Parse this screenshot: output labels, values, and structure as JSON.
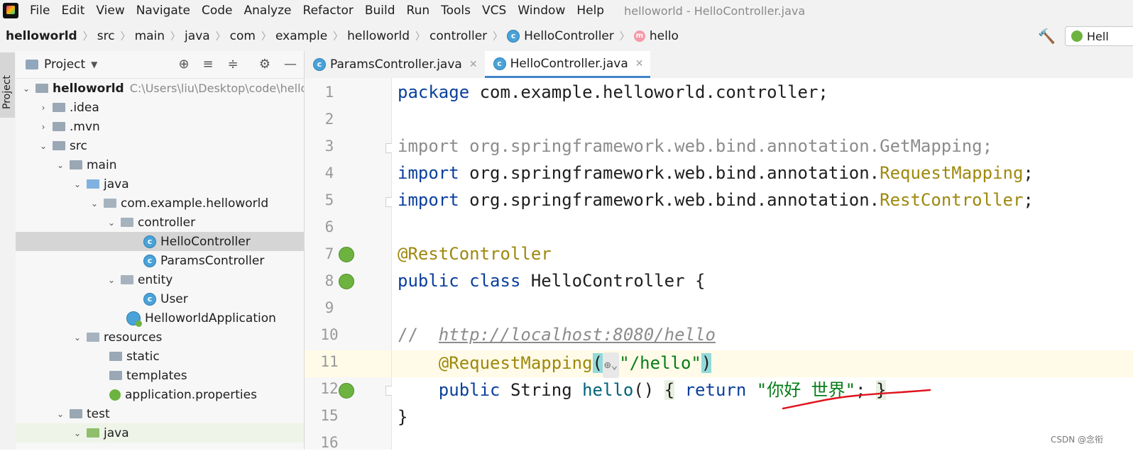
{
  "menu": {
    "items": [
      "File",
      "Edit",
      "View",
      "Navigate",
      "Code",
      "Analyze",
      "Refactor",
      "Build",
      "Run",
      "Tools",
      "VCS",
      "Window",
      "Help"
    ],
    "window_title": "helloworld - HelloController.java"
  },
  "breadcrumb": {
    "items": [
      "helloworld",
      "src",
      "main",
      "java",
      "com",
      "example",
      "helloworld",
      "controller",
      "HelloController",
      "hello"
    ],
    "run_config": "Hell"
  },
  "tool_strip": {
    "project_tab": "Project"
  },
  "project_panel": {
    "title": "Project",
    "tree": [
      {
        "label": "helloworld",
        "path": "C:\\Users\\liu\\Desktop\\code\\hello"
      },
      {
        "label": ".idea"
      },
      {
        "label": ".mvn"
      },
      {
        "label": "src"
      },
      {
        "label": "main"
      },
      {
        "label": "java"
      },
      {
        "label": "com.example.helloworld"
      },
      {
        "label": "controller"
      },
      {
        "label": "HelloController"
      },
      {
        "label": "ParamsController"
      },
      {
        "label": "entity"
      },
      {
        "label": "User"
      },
      {
        "label": "HelloworldApplication"
      },
      {
        "label": "resources"
      },
      {
        "label": "static"
      },
      {
        "label": "templates"
      },
      {
        "label": "application.properties"
      },
      {
        "label": "test"
      },
      {
        "label": "java"
      }
    ]
  },
  "editor": {
    "tabs": [
      {
        "label": "ParamsController.java",
        "active": false
      },
      {
        "label": "HelloController.java",
        "active": true
      }
    ],
    "line_numbers": [
      "1",
      "2",
      "3",
      "4",
      "5",
      "6",
      "7",
      "8",
      "9",
      "10",
      "11",
      "12",
      "15",
      "16"
    ],
    "code": {
      "l1_kw": "package",
      "l1_rest": " com.example.helloworld.controller;",
      "l3": "import org.springframework.web.bind.annotation.GetMapping;",
      "l4_kw": "import",
      "l4_rest": " org.springframework.web.bind.annotation.",
      "l4_cls": "RequestMapping",
      "l4_end": ";",
      "l5_kw": "import",
      "l5_rest": " org.springframework.web.bind.annotation.",
      "l5_cls": "RestController",
      "l5_end": ";",
      "l7": "@RestController",
      "l8_kw": "public class",
      "l8_rest": " HelloController {",
      "l10_cmt": "//  ",
      "l10_url": "http://localhost:8080/hello",
      "l11_ann": "    @RequestMapping",
      "l11_open": "(",
      "l11_str": "\"/hello\"",
      "l11_close": ")",
      "l12_kw1": "    public",
      "l12_type": " String ",
      "l12_name": "hello",
      "l12_paren": "() ",
      "l12_brace1": "{",
      "l12_kw2": " return ",
      "l12_str": "\"你好 世界\"",
      "l12_semi": "; ",
      "l12_brace2": "}",
      "l15": "}"
    }
  },
  "watermark": "CSDN @念衔"
}
